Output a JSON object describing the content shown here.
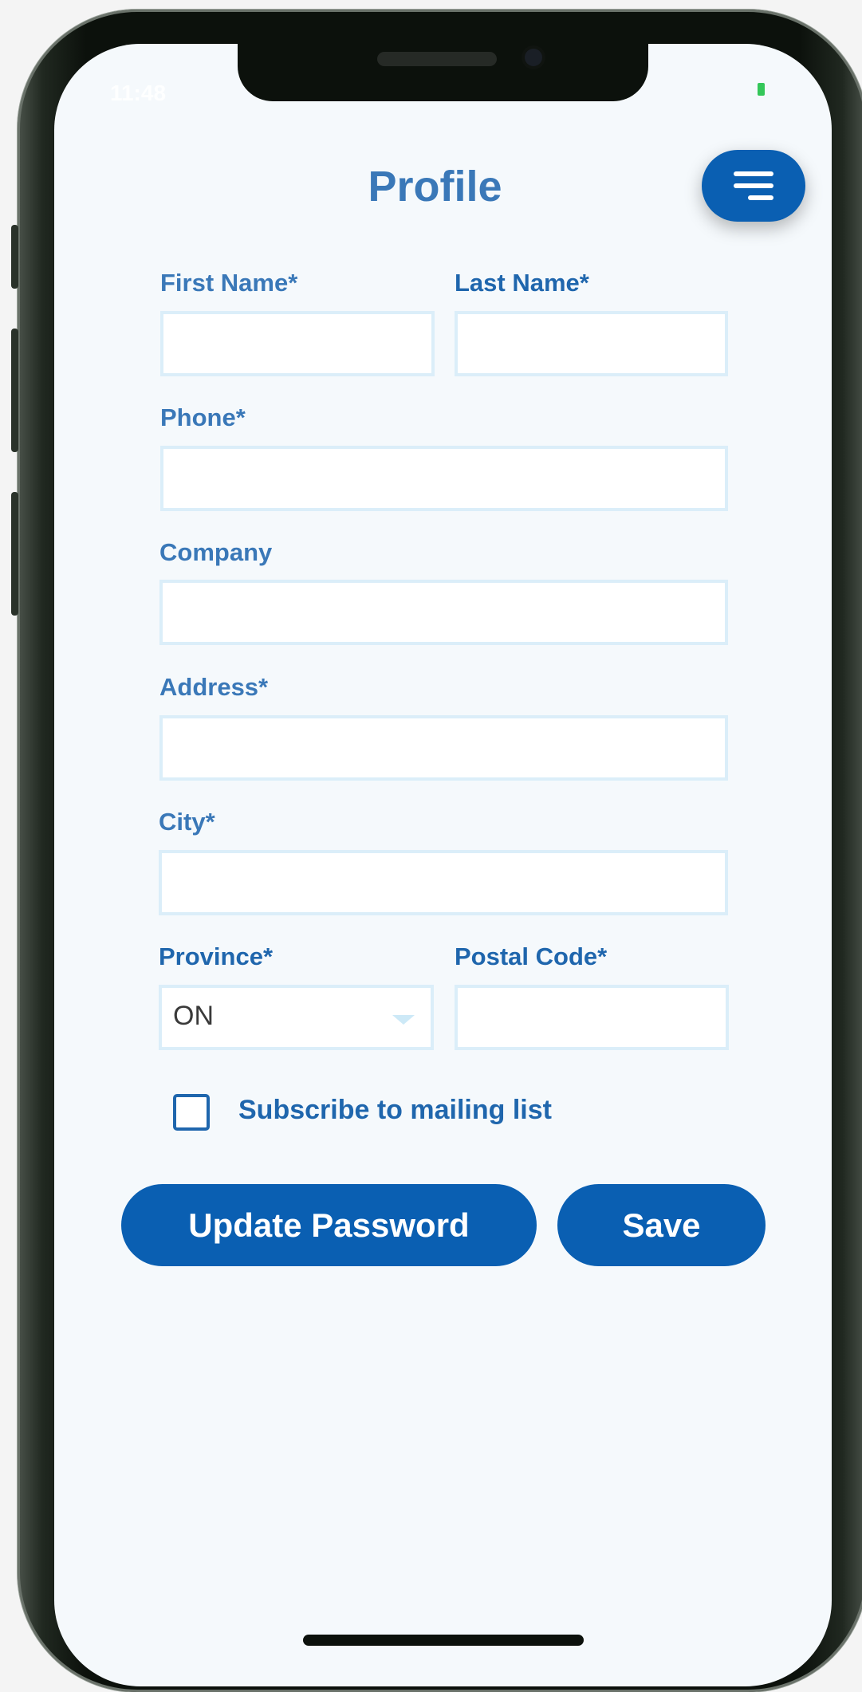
{
  "status_bar": {
    "time": "11:48"
  },
  "header": {
    "title": "Profile",
    "menu_icon": "hamburger-menu-icon"
  },
  "form": {
    "first_name": {
      "label": "First Name*",
      "value": ""
    },
    "last_name": {
      "label": "Last Name*",
      "value": ""
    },
    "phone": {
      "label": "Phone*",
      "value": ""
    },
    "company": {
      "label": "Company",
      "value": ""
    },
    "address": {
      "label": "Address*",
      "value": ""
    },
    "city": {
      "label": "City*",
      "value": ""
    },
    "province": {
      "label": "Province*",
      "value": "ON"
    },
    "postal_code": {
      "label": "Postal Code*",
      "value": ""
    },
    "subscribe": {
      "label": "Subscribe to mailing list",
      "checked": false
    }
  },
  "actions": {
    "update_password": "Update Password",
    "save": "Save"
  },
  "colors": {
    "primary": "#0a5fb2",
    "label": "#3a78b8",
    "input_border": "#dbeef9",
    "background": "#f5f9fc"
  }
}
